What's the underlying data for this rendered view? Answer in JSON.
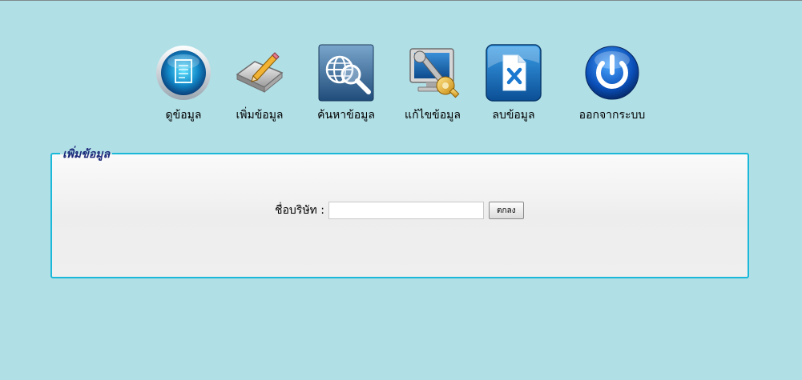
{
  "toolbar": {
    "items": [
      {
        "label": "ดูข้อมูล",
        "icon": "view-document-icon"
      },
      {
        "label": "เพิ่มข้อมูล",
        "icon": "add-folder-pencil-icon"
      },
      {
        "label": "ค้นหาข้อมูล",
        "icon": "search-globe-icon"
      },
      {
        "label": "แก้ไขข้อมูล",
        "icon": "edit-monitor-wrench-icon"
      },
      {
        "label": "ลบข้อมูล",
        "icon": "delete-file-icon"
      },
      {
        "label": "ออกจากระบบ",
        "icon": "power-icon"
      }
    ]
  },
  "panel": {
    "legend": "เพิ่มข้อมูล",
    "company_label": "ชื่อบริษัท :",
    "company_value": "",
    "submit_label": "ตกลง"
  },
  "colors": {
    "background": "#b1dfe6",
    "panel_border": "#1ab8d9",
    "legend_text": "#1d2a7a"
  }
}
